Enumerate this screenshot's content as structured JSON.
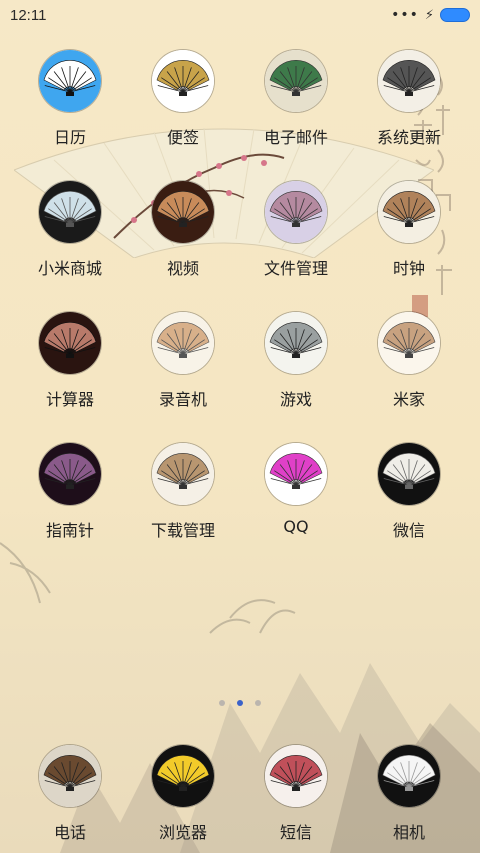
{
  "status": {
    "time": "12:11",
    "more_glyph": "•••",
    "charge_icon": "bolt-icon",
    "battery_color": "#2f8bff"
  },
  "apps": [
    {
      "label": "日历",
      "icon": "fan-blue-icon"
    },
    {
      "label": "便签",
      "icon": "fan-mono-icon"
    },
    {
      "label": "电子邮件",
      "icon": "fan-landscape-icon"
    },
    {
      "label": "系统更新",
      "icon": "fan-calligraphy-icon"
    },
    {
      "label": "小米商城",
      "icon": "fan-dark-icon"
    },
    {
      "label": "视频",
      "icon": "fan-bamboo-icon"
    },
    {
      "label": "文件管理",
      "icon": "fan-pink-icon"
    },
    {
      "label": "时钟",
      "icon": "fan-wood-icon"
    },
    {
      "label": "计算器",
      "icon": "fan-red-icon"
    },
    {
      "label": "录音机",
      "icon": "fan-beige-icon"
    },
    {
      "label": "游戏",
      "icon": "fan-ink-icon"
    },
    {
      "label": "米家",
      "icon": "fan-painted-icon"
    },
    {
      "label": "指南针",
      "icon": "fan-purple-icon"
    },
    {
      "label": "下载管理",
      "icon": "fan-bamboo-light-icon"
    },
    {
      "label": "QQ",
      "icon": "fan-magenta-icon"
    },
    {
      "label": "微信",
      "icon": "fan-black-white-icon"
    }
  ],
  "dock": [
    {
      "label": "电话",
      "icon": "fan-stand-icon"
    },
    {
      "label": "浏览器",
      "icon": "fan-yellow-icon"
    },
    {
      "label": "短信",
      "icon": "fan-floral-icon"
    },
    {
      "label": "相机",
      "icon": "fan-lace-icon"
    }
  ],
  "pager": {
    "pages": 3,
    "current": 2
  }
}
